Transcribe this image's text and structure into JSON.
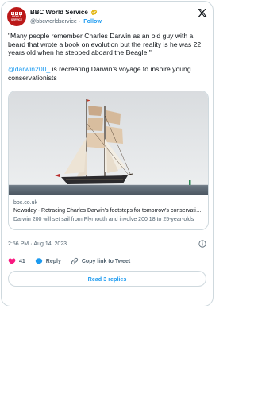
{
  "account": {
    "avatar_top": "BBC",
    "avatar_bottom": "WORLD SERVICE",
    "display_name": "BBC World Service",
    "handle": "@bbcworldservice",
    "separator": "·",
    "follow_label": "Follow"
  },
  "tweet": {
    "quote": "\"Many people remember Charles Darwin as an old guy with a beard that wrote a book on evolution but the reality is he was 22 years old when he stepped aboard the Beagle.\"",
    "mention": "@darwin200_",
    "rest": " is recreating Darwin's voyage to inspire young conservationists"
  },
  "link_card": {
    "domain": "bbc.co.uk",
    "title": "Newsday - Retracing Charles Darwin's footsteps for tomorrow's conservationists",
    "description": "Darwin 200 will set sail from Plymouth and involve 200 18 to 25-year-olds"
  },
  "meta": {
    "time": "2:56 PM",
    "separator": "·",
    "date": "Aug 14, 2023"
  },
  "actions": {
    "likes": "41",
    "reply_label": "Reply",
    "copy_label": "Copy link to Tweet"
  },
  "replies_button": "Read 3 replies",
  "colors": {
    "accent": "#1d9bf0",
    "like": "#f91880",
    "bbc_red": "#bb1919",
    "verified_gold": "#e2b719"
  }
}
